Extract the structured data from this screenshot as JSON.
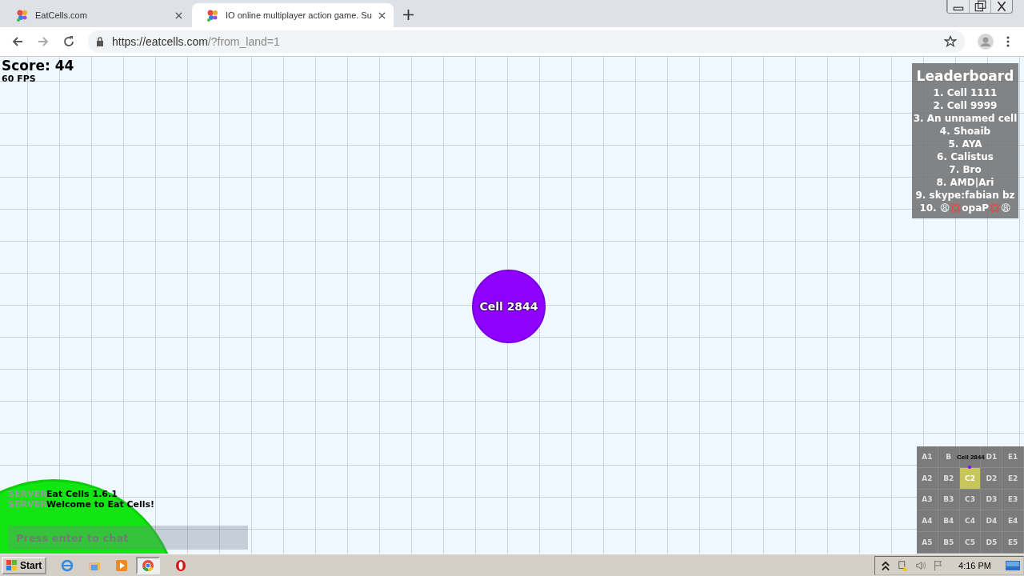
{
  "tabs": [
    {
      "title": "EatCells.com",
      "selected": false
    },
    {
      "title": "IO online multiplayer action game. Su",
      "selected": true
    }
  ],
  "address_bar": {
    "url_host": "https://eatcells.com",
    "url_path": "/?from_land=1"
  },
  "hud": {
    "score": "Score: 44",
    "fps": "60 FPS"
  },
  "player_cell": {
    "name": "Cell 2844"
  },
  "leaderboard": {
    "title": "Leaderboard",
    "entries": [
      "1. Cell 1111",
      "2. Cell 9999",
      "3. An unnamed cell",
      "4. Shoaib",
      "5. AYA",
      "6. Calistus",
      "7. Bro",
      "8. AMD|Ari",
      "9. skype:fabian bz",
      "10. 😩💢opaP💢😩"
    ]
  },
  "minimap": {
    "player_label": "Cell 2844",
    "rows": [
      [
        {
          "label": "A1",
          "selected": false
        },
        {
          "label": "B",
          "selected": false
        },
        {
          "selected": false
        },
        {
          "label": "D1",
          "selected": false
        },
        {
          "label": "E1",
          "selected": false
        }
      ],
      [
        {
          "label": "A2",
          "selected": false
        },
        {
          "label": "B2",
          "selected": false
        },
        {
          "label": "C2",
          "selected": true
        },
        {
          "label": "D2",
          "selected": false
        },
        {
          "label": "E2",
          "selected": false
        }
      ],
      [
        {
          "label": "A3",
          "selected": false
        },
        {
          "label": "B3",
          "selected": false
        },
        {
          "label": "C3",
          "selected": false
        },
        {
          "label": "D3",
          "selected": false
        },
        {
          "label": "E3",
          "selected": false
        }
      ],
      [
        {
          "label": "A4",
          "selected": false
        },
        {
          "label": "B4",
          "selected": false
        },
        {
          "label": "C4",
          "selected": false
        },
        {
          "label": "D4",
          "selected": false
        },
        {
          "label": "E4",
          "selected": false
        }
      ],
      [
        {
          "label": "A5",
          "selected": false
        },
        {
          "label": "B5",
          "selected": false
        },
        {
          "label": "C5",
          "selected": false
        },
        {
          "label": "D5",
          "selected": false
        },
        {
          "label": "E5",
          "selected": false
        }
      ]
    ]
  },
  "chat": {
    "messages": [
      {
        "sender": "SERVER",
        "text": "Eat Cells 1.6.1"
      },
      {
        "sender": "SERVER",
        "text": "Welcome to Eat Cells!"
      }
    ],
    "placeholder": "Press enter to chat"
  },
  "taskbar": {
    "start": "Start",
    "clock": "4:16 PM"
  }
}
